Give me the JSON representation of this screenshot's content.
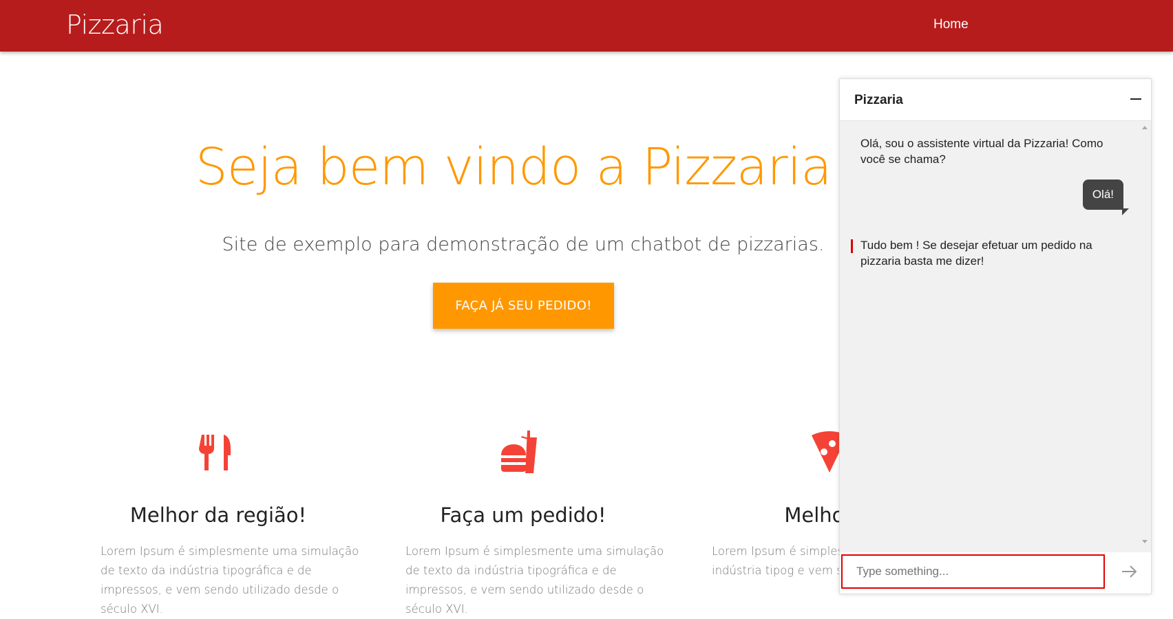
{
  "navbar": {
    "brand": "Pizzaria",
    "home": "Home",
    "color": "#b71c1c"
  },
  "hero": {
    "title": "Seja bem vindo a Pizzaria!",
    "subtitle": "Site de exemplo para demonstração de um chatbot de pizzarias.",
    "cta": "FAÇA JÁ SEU PEDIDO!",
    "accent": "#ff9800"
  },
  "features": [
    {
      "icon": "fork-knife-icon",
      "title": "Melhor da região!",
      "text": "Lorem Ipsum é simplesmente uma simulação de texto da indústria tipográfica e de impressos, e vem sendo utilizado desde o século XVI."
    },
    {
      "icon": "fast-food-icon",
      "title": "Faça um pedido!",
      "text": "Lorem Ipsum é simplesmente uma simulação de texto da indústria tipográfica e de impressos, e vem sendo utilizado desde o século XVI."
    },
    {
      "icon": "pizza-slice-icon",
      "title": "Melhores",
      "text": "Lorem Ipsum é simplesme de texto da indústria tipog e vem sendo utilizado des"
    }
  ],
  "chat": {
    "title": "Pizzaria",
    "messages": [
      {
        "from": "bot",
        "text": "Olá, sou o assistente virtual da Pizzaria! Como você se chama?"
      },
      {
        "from": "user",
        "text": "Olá!"
      },
      {
        "from": "bot",
        "text": "Tudo bem ! Se desejar efetuar um pedido na pizzaria basta me dizer!"
      }
    ],
    "input_placeholder": "Type something..."
  }
}
